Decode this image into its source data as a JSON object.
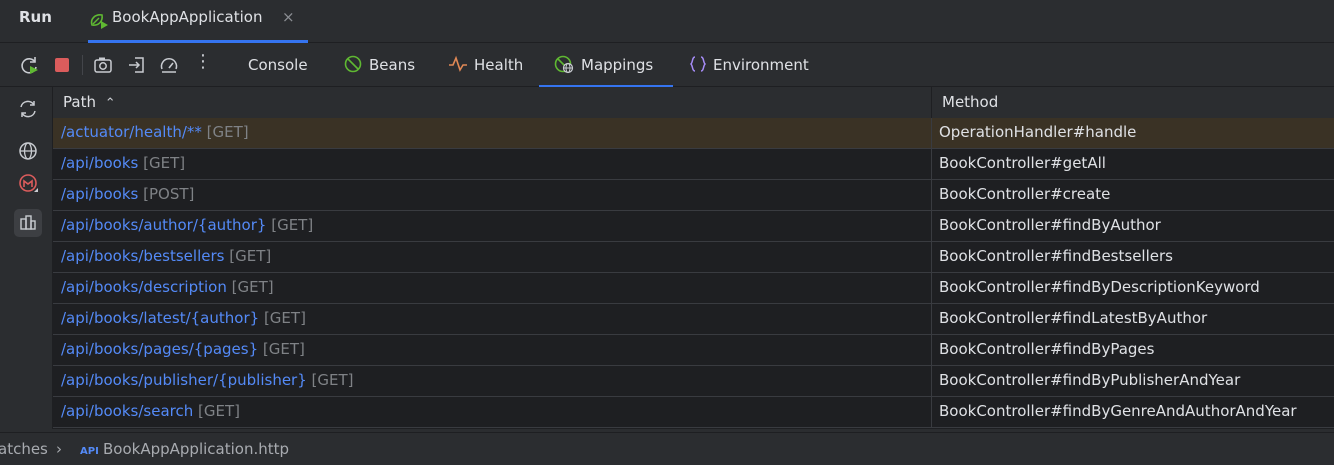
{
  "run_tool": {
    "label": "Run",
    "tab": {
      "label": "BookAppApplication",
      "close": "×"
    }
  },
  "toolbar": {
    "icons": [
      "rerun-icon",
      "stop-icon",
      "camera-icon",
      "exit-icon",
      "gauge-icon",
      "more-icon"
    ],
    "more_glyph": "⋮",
    "tabs": [
      {
        "label": "Console"
      },
      {
        "label": "Beans"
      },
      {
        "label": "Health"
      },
      {
        "label": "Mappings"
      },
      {
        "label": "Environment"
      }
    ],
    "active_tab": "Mappings"
  },
  "sidebar": {
    "icons": [
      "refresh-icon",
      "globe-icon",
      "micrometer-icon",
      "structure-icon"
    ]
  },
  "table": {
    "columns": {
      "path": "Path",
      "path_sort": "⌃",
      "method": "Method"
    },
    "rows": [
      {
        "url": "/actuator/health/**",
        "verb": "[GET]",
        "method": "OperationHandler#handle",
        "selected": true
      },
      {
        "url": "/api/books",
        "verb": "[GET]",
        "method": "BookController#getAll"
      },
      {
        "url": "/api/books",
        "verb": "[POST]",
        "method": "BookController#create"
      },
      {
        "url": "/api/books/author/{author}",
        "verb": "[GET]",
        "method": "BookController#findByAuthor"
      },
      {
        "url": "/api/books/bestsellers",
        "verb": "[GET]",
        "method": "BookController#findBestsellers"
      },
      {
        "url": "/api/books/description",
        "verb": "[GET]",
        "method": "BookController#findByDescriptionKeyword"
      },
      {
        "url": "/api/books/latest/{author}",
        "verb": "[GET]",
        "method": "BookController#findLatestByAuthor"
      },
      {
        "url": "/api/books/pages/{pages}",
        "verb": "[GET]",
        "method": "BookController#findByPages"
      },
      {
        "url": "/api/books/publisher/{publisher}",
        "verb": "[GET]",
        "method": "BookController#findByPublisherAndYear"
      },
      {
        "url": "/api/books/search",
        "verb": "[GET]",
        "method": "BookController#findByGenreAndAuthorAndYear"
      }
    ]
  },
  "status": {
    "crumb": "atches",
    "chevron": "›",
    "file": "BookAppApplication.http"
  },
  "colors": {
    "accent": "#3574f0",
    "url": "#548af7",
    "selected_row": "#3a3225",
    "stop": "#db5c5c"
  }
}
